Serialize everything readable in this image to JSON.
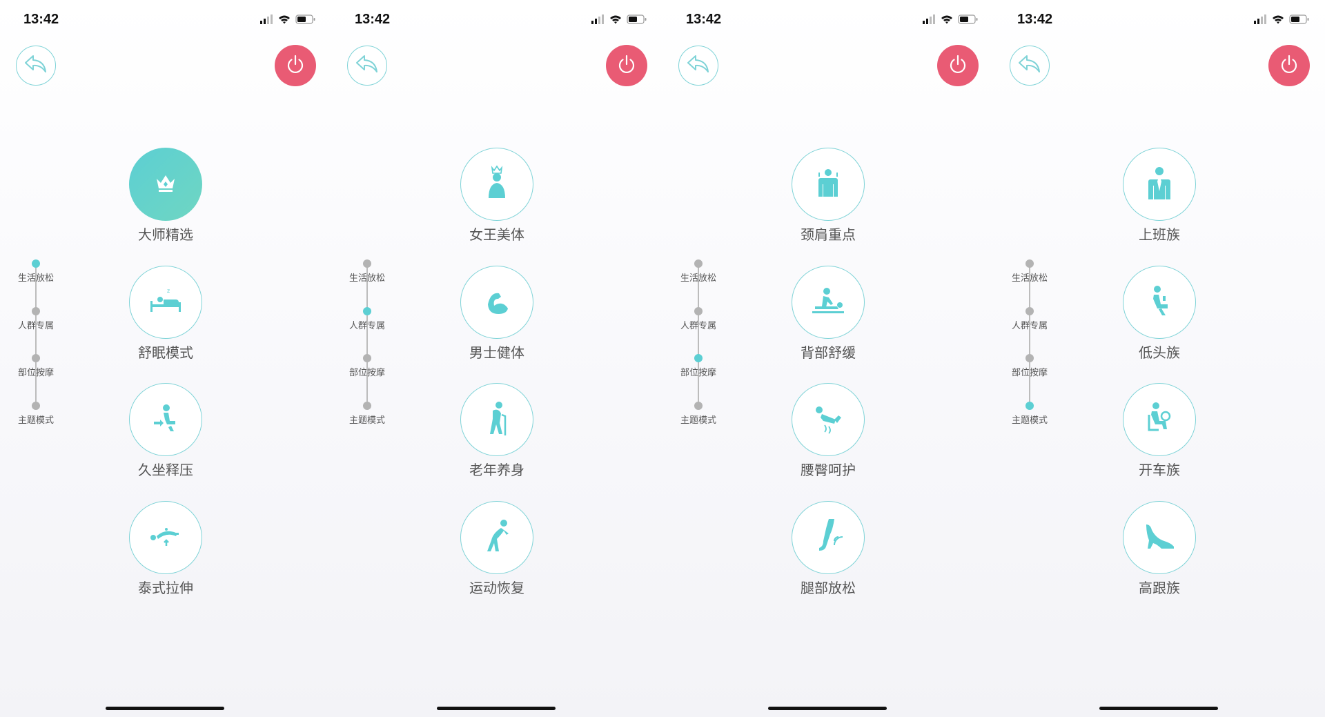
{
  "screens": [
    {
      "time": "13:42",
      "categories": [
        "生活放松",
        "人群专属",
        "部位按摩",
        "主题模式"
      ],
      "active_category": 0,
      "modes": [
        {
          "label": "大师精选",
          "icon": "crown-icon",
          "active": true
        },
        {
          "label": "舒眠模式",
          "icon": "sleeping-bed-icon",
          "active": false
        },
        {
          "label": "久坐释压",
          "icon": "sitting-person-icon",
          "active": false
        },
        {
          "label": "泰式拉伸",
          "icon": "thai-stretch-icon",
          "active": false
        }
      ]
    },
    {
      "time": "13:42",
      "categories": [
        "生活放松",
        "人群专属",
        "部位按摩",
        "主题模式"
      ],
      "active_category": 1,
      "modes": [
        {
          "label": "女王美体",
          "icon": "queen-icon",
          "active": false
        },
        {
          "label": "男士健体",
          "icon": "muscle-arm-icon",
          "active": false
        },
        {
          "label": "老年养身",
          "icon": "elderly-cane-icon",
          "active": false
        },
        {
          "label": "运动恢复",
          "icon": "sport-stretch-icon",
          "active": false
        }
      ]
    },
    {
      "time": "13:42",
      "categories": [
        "生活放松",
        "人群专属",
        "部位按摩",
        "主题模式"
      ],
      "active_category": 2,
      "modes": [
        {
          "label": "颈肩重点",
          "icon": "neck-shoulder-icon",
          "active": false
        },
        {
          "label": "背部舒缓",
          "icon": "back-massage-icon",
          "active": false
        },
        {
          "label": "腰臀呵护",
          "icon": "waist-hip-icon",
          "active": false
        },
        {
          "label": "腿部放松",
          "icon": "leg-relax-icon",
          "active": false
        }
      ]
    },
    {
      "time": "13:42",
      "categories": [
        "生活放松",
        "人群专属",
        "部位按摩",
        "主题模式"
      ],
      "active_category": 3,
      "modes": [
        {
          "label": "上班族",
          "icon": "office-worker-icon",
          "active": false
        },
        {
          "label": "低头族",
          "icon": "phone-user-icon",
          "active": false
        },
        {
          "label": "开车族",
          "icon": "driver-icon",
          "active": false
        },
        {
          "label": "高跟族",
          "icon": "high-heel-icon",
          "active": false
        }
      ]
    }
  ],
  "colors": {
    "accent": "#5ccfd3",
    "power_button": "#e95b74",
    "label_text": "#555555",
    "timeline_inactive": "#b3b3b3"
  }
}
